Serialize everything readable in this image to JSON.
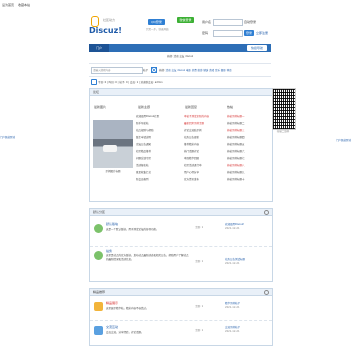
{
  "topbar": {
    "left1": "设为首页",
    "left2": "收藏本站"
  },
  "header": {
    "logo_text": "Discuz!",
    "logo_sub": "社区动力",
    "qq_btn": "QQ登录",
    "qq_sub": "只需一步，快速开始",
    "wx_btn": "微信登录",
    "user_label": "用户名",
    "pass_label": "密码",
    "auto_login": "自动登录",
    "find_pw": "找回密码",
    "login_btn": "登录",
    "register": "立即注册"
  },
  "nav": {
    "home": "门户",
    "bbs": "论坛",
    "right_link": "快捷导航"
  },
  "subnav": {
    "text": "热搜: 活动 交友 discuz"
  },
  "search": {
    "placeholder": "请输入搜索内容",
    "scope": "帖子",
    "btn": "搜索",
    "hot": [
      "热搜:",
      "活动",
      "交友",
      "discuz",
      "电影",
      "美食",
      "旅游",
      "健身",
      "游戏",
      "音乐",
      "摄影",
      "体育"
    ]
  },
  "breadcrumb": "今日: 0 | 昨日: 0 | 帖子: 0 | 会员: 1 | 欢迎新会员: admin",
  "portal": {
    "title": "论坛",
    "cols": [
      "最新图片",
      "最新主题",
      "最新回复",
      "热帖"
    ],
    "slide_caption": "示例图片标题",
    "list1": [
      "欢迎使用Discuz社区",
      "新手导航帖",
      "站点规则与帮助",
      "版主申请说明",
      "论坛公告通知",
      "社区精品推荐",
      "问题反馈专区",
      "活动报名帖",
      "意见收集汇总",
      "新会员报到"
    ],
    "list2": [
      "本帖子测试全新的内容",
      "最新回复示例主题",
      "讨论交流贴示例",
      "站务公告更新",
      "推荐精彩内容",
      "热门话题讨论",
      "本周精华回顾",
      "社区活动进行中",
      "用户心得分享",
      "官方资讯发布"
    ],
    "list3": [
      "热帖示例标题一",
      "热帖示例标题二",
      "热帖示例标题三",
      "热帖示例标题四",
      "热帖示例标题五",
      "热帖示例标题六",
      "热帖示例标题七",
      "热帖示例标题八",
      "热帖示例标题九",
      "热帖示例标题十"
    ],
    "qr_caption": "扫描二维码"
  },
  "forum1": {
    "title": "默认分区",
    "boards": [
      {
        "name": "默认版块",
        "desc": "这是一个默认版块，用于测试论坛的各项功能。",
        "stats": "主题: 1",
        "last": "欢迎使用Discuz!",
        "date": "2021-12-21"
      },
      {
        "name": "站务",
        "desc": "这里是站点的官方版块，发布站点最新动态和相关公告，帮助用户了解站点的最新情况和活动信息。",
        "stats": "主题: 1",
        "last": "站务公告测试标题",
        "date": "2021-12-21"
      }
    ]
  },
  "forum2": {
    "title": "精品推荐",
    "boards": [
      {
        "name": "精品展示",
        "desc": "这里展示精华帖，精彩内容不容错过。",
        "stats": "主题: 1",
        "last": "精华示例帖子",
        "date": "2021-12-21"
      },
      {
        "name": "交流互动",
        "desc": "会员交流，分享经验，讨论话题。",
        "stats": "主题: 1",
        "last": "交流示例帖子",
        "date": "2021-12-21"
      }
    ]
  },
  "side": {
    "left": "门户频道区域",
    "right": "门户频道区域"
  },
  "colors": {
    "nav": "#2d6eb6",
    "accent": "#2f7fd3",
    "red": "#d42a2a"
  }
}
